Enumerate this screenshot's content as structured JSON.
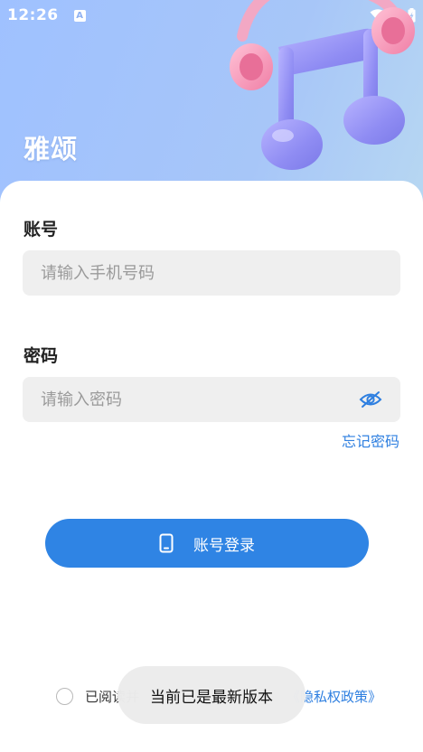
{
  "status_bar": {
    "time": "12:26",
    "notification_badge": "A"
  },
  "app": {
    "title": "雅颂"
  },
  "form": {
    "account_label": "账号",
    "account_placeholder": "请输入手机号码",
    "password_label": "密码",
    "password_placeholder": "请输入密码",
    "forgot_label": "忘记密码"
  },
  "login": {
    "label": "账号登录"
  },
  "agreement": {
    "prefix": "已阅读并",
    "link": "《隐私权政策》"
  },
  "toast": {
    "message": "当前已是最新版本"
  },
  "colors": {
    "primary": "#2f84e4",
    "link": "#2e7fe0",
    "input_bg": "#efefef"
  },
  "icons": {
    "hero": "music-note-headphones-icon",
    "password_toggle": "eye-hidden-icon",
    "login": "phone-icon"
  }
}
